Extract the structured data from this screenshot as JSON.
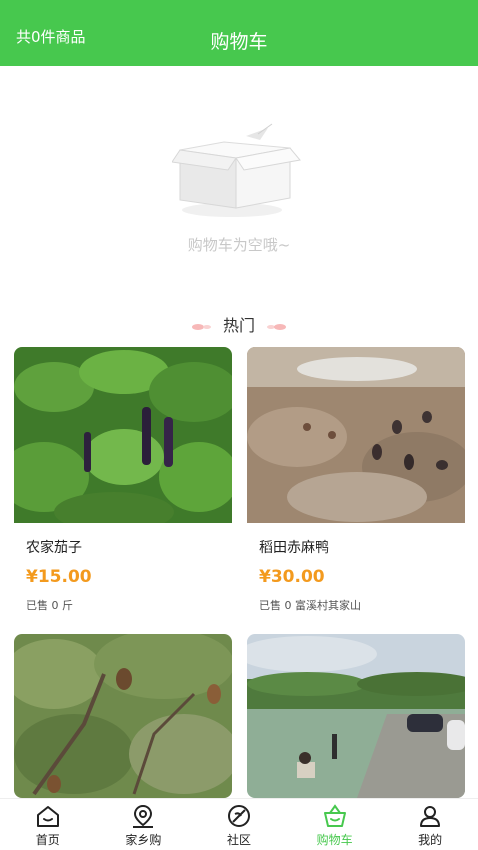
{
  "header": {
    "count_text": "共0件商品",
    "title": "购物车"
  },
  "empty_state": {
    "message": "购物车为空哦~"
  },
  "hot_section": {
    "title": "热门"
  },
  "products": [
    {
      "name": "农家茄子",
      "price": "¥15.00",
      "meta": "已售 0 斤"
    },
    {
      "name": "稻田赤麻鸭",
      "price": "¥30.00",
      "meta": "已售 0 富溪村其家山"
    },
    {
      "name": "",
      "price": "",
      "meta": ""
    },
    {
      "name": "",
      "price": "",
      "meta": ""
    }
  ],
  "nav": {
    "items": [
      {
        "label": "首页",
        "icon": "home-icon"
      },
      {
        "label": "家乡购",
        "icon": "map-pin-icon"
      },
      {
        "label": "社区",
        "icon": "leaf-icon"
      },
      {
        "label": "购物车",
        "icon": "basket-icon",
        "active": true
      },
      {
        "label": "我的",
        "icon": "user-icon"
      }
    ]
  },
  "colors": {
    "brand": "#47c84e",
    "price": "#f39a1e"
  }
}
